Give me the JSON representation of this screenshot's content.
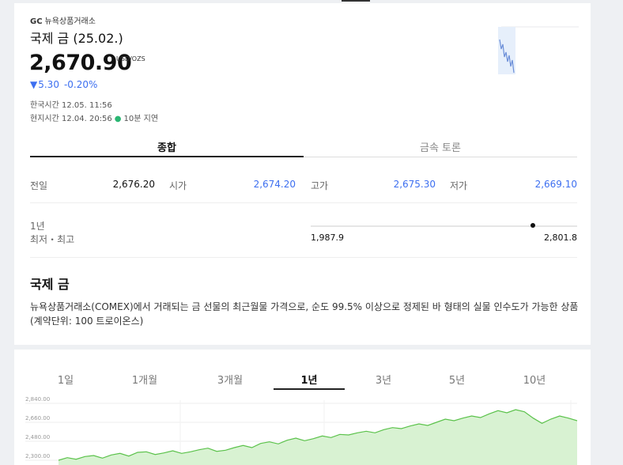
{
  "header": {
    "exchange_code": "GC",
    "exchange_name": "뉴욕상품거래소",
    "title": "국제 금 (25.02.)",
    "price": "2,670.90",
    "unit": "USD/OZS",
    "change_arrow": "▼",
    "change": "5.30",
    "change_pct": "-0.20%",
    "kst_time": "한국시간 12.05. 11:56",
    "local_time": "현지시간 12.04. 20:56",
    "delay_dot": "●",
    "delay": "10분 지연"
  },
  "tabs": [
    "종합",
    "금속 토론"
  ],
  "stats": {
    "prev_label": "전일",
    "prev_value": "2,676.20",
    "open_label": "시가",
    "open_value": "2,674.20",
    "high_label": "고가",
    "high_value": "2,675.30",
    "low_label": "저가",
    "low_value": "2,669.10"
  },
  "year_range": {
    "label_1": "1년",
    "label_2": "최저・최고",
    "low": "1,987.9",
    "high": "2,801.8",
    "current_fraction": 0.835
  },
  "description": {
    "title": "국제 금",
    "text": "뉴욕상품거래소(COMEX)에서 거래되는 금 선물의 최근월물 가격으로, 순도 99.5% 이상으로 정제된 바 형태의 실물 인수도가 가능한 상품 (계약단위: 100 트로이온스)"
  },
  "period_tabs": [
    "1일",
    "1개월",
    "3개월",
    "1년",
    "3년",
    "5년",
    "10년"
  ],
  "active_period": "1년",
  "colors": {
    "down": "#3d6ff0",
    "chart_line": "#5bc24b",
    "chart_fill": "#d8f2d2",
    "delay_dot": "#2bb673"
  },
  "chart_data": {
    "type": "area",
    "ytick_labels": [
      "2,840.00",
      "2,660.00",
      "2,480.00",
      "2,300.00"
    ],
    "ylim": [
      2300,
      2840
    ],
    "x": [
      0,
      1,
      2,
      3,
      4,
      5,
      6,
      7,
      8,
      9,
      10,
      11,
      12,
      13,
      14,
      15,
      16,
      17,
      18,
      19,
      20,
      21,
      22,
      23,
      24,
      25,
      26,
      27,
      28,
      29,
      30,
      31,
      32,
      33,
      34,
      35,
      36,
      37,
      38,
      39,
      40,
      41,
      42,
      43,
      44,
      45,
      46,
      47,
      48,
      49,
      50,
      51,
      52,
      53,
      54,
      55,
      56,
      57,
      58,
      59
    ],
    "values": [
      2300,
      2325,
      2310,
      2335,
      2345,
      2320,
      2350,
      2365,
      2340,
      2375,
      2380,
      2355,
      2370,
      2390,
      2365,
      2380,
      2400,
      2415,
      2385,
      2395,
      2420,
      2440,
      2420,
      2460,
      2475,
      2455,
      2490,
      2510,
      2485,
      2505,
      2530,
      2515,
      2545,
      2540,
      2560,
      2575,
      2560,
      2590,
      2610,
      2600,
      2625,
      2645,
      2630,
      2660,
      2690,
      2675,
      2700,
      2720,
      2705,
      2740,
      2770,
      2750,
      2780,
      2760,
      2700,
      2650,
      2690,
      2720,
      2700,
      2675
    ]
  }
}
